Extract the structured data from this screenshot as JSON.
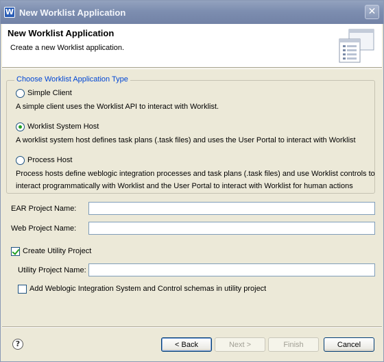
{
  "window": {
    "title": "New Worklist Application"
  },
  "banner": {
    "title": "New Worklist Application",
    "description": "Create a new Worklist application."
  },
  "app_type_group": {
    "legend": "Choose Worklist Application Type",
    "options": [
      {
        "label": "Simple Client",
        "checked": false,
        "description": [
          "A simple client uses the Worklist API to interact with Worklist."
        ]
      },
      {
        "label": "Worklist System Host",
        "checked": true,
        "description": [
          "A worklist system host defines task plans (.task files) and uses the User Portal to interact with Worklist"
        ]
      },
      {
        "label": "Process Host",
        "checked": false,
        "description": [
          "Process hosts define weblogic integration processes and task plans (.task files) and use Worklist controls to",
          "interact programmatically with Worklist and the User Portal to interact with Worklist for human actions"
        ]
      }
    ]
  },
  "form": {
    "ear_project_label": "EAR Project Name:",
    "ear_project_value": "",
    "web_project_label": "Web Project Name:",
    "web_project_value": "",
    "create_utility_label": "Create Utility Project",
    "create_utility_checked": true,
    "utility_project_label": "Utility Project Name:",
    "utility_project_value": "",
    "add_schemas_label": "Add Weblogic Integration System and Control schemas in utility project",
    "add_schemas_checked": false
  },
  "buttons": {
    "back": "< Back",
    "next": "Next >",
    "finish": "Finish",
    "cancel": "Cancel"
  },
  "icons": {
    "app": "app-icon",
    "close": "close-icon",
    "help": "help-icon",
    "banner": "wizard-banner-icon"
  }
}
